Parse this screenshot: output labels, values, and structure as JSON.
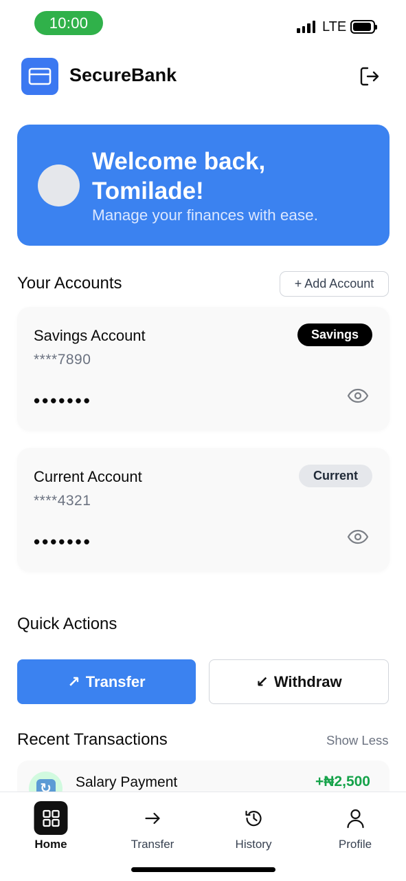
{
  "status_bar": {
    "time": "10:00",
    "network": "LTE",
    "time_pill_color": "#30b14a"
  },
  "header": {
    "app_name": "SecureBank",
    "logo_icon": "credit-card-icon",
    "logout_icon": "logout-icon"
  },
  "welcome": {
    "title": "Welcome back, Tomilade!",
    "subtitle": "Manage your finances with ease.",
    "bg_color": "#3b82f0"
  },
  "accounts_section": {
    "title": "Your Accounts",
    "add_button": "+ Add Account"
  },
  "accounts": [
    {
      "name": "Savings Account",
      "number": "****7890",
      "badge": "Savings",
      "balance_masked": "•••••••",
      "eye_icon": "eye-icon"
    },
    {
      "name": "Current Account",
      "number": "****4321",
      "badge": "Current",
      "balance_masked": "•••••••",
      "eye_icon": "eye-icon"
    }
  ],
  "quick_actions": {
    "title": "Quick Actions",
    "transfer": {
      "arrow": "↗",
      "label": "Transfer"
    },
    "withdraw": {
      "arrow": "↙",
      "label": "Withdraw"
    }
  },
  "transactions": {
    "title": "Recent Transactions",
    "toggle": "Show Less",
    "items": [
      {
        "title": "Salary Payment",
        "amount": "+₦2,500",
        "amount_color": "#16a34a"
      }
    ]
  },
  "bottom_nav": [
    {
      "label": "Home",
      "icon": "grid-icon",
      "active": true
    },
    {
      "label": "Transfer",
      "icon": "arrow-right-icon",
      "active": false
    },
    {
      "label": "History",
      "icon": "history-icon",
      "active": false
    },
    {
      "label": "Profile",
      "icon": "user-icon",
      "active": false
    }
  ]
}
